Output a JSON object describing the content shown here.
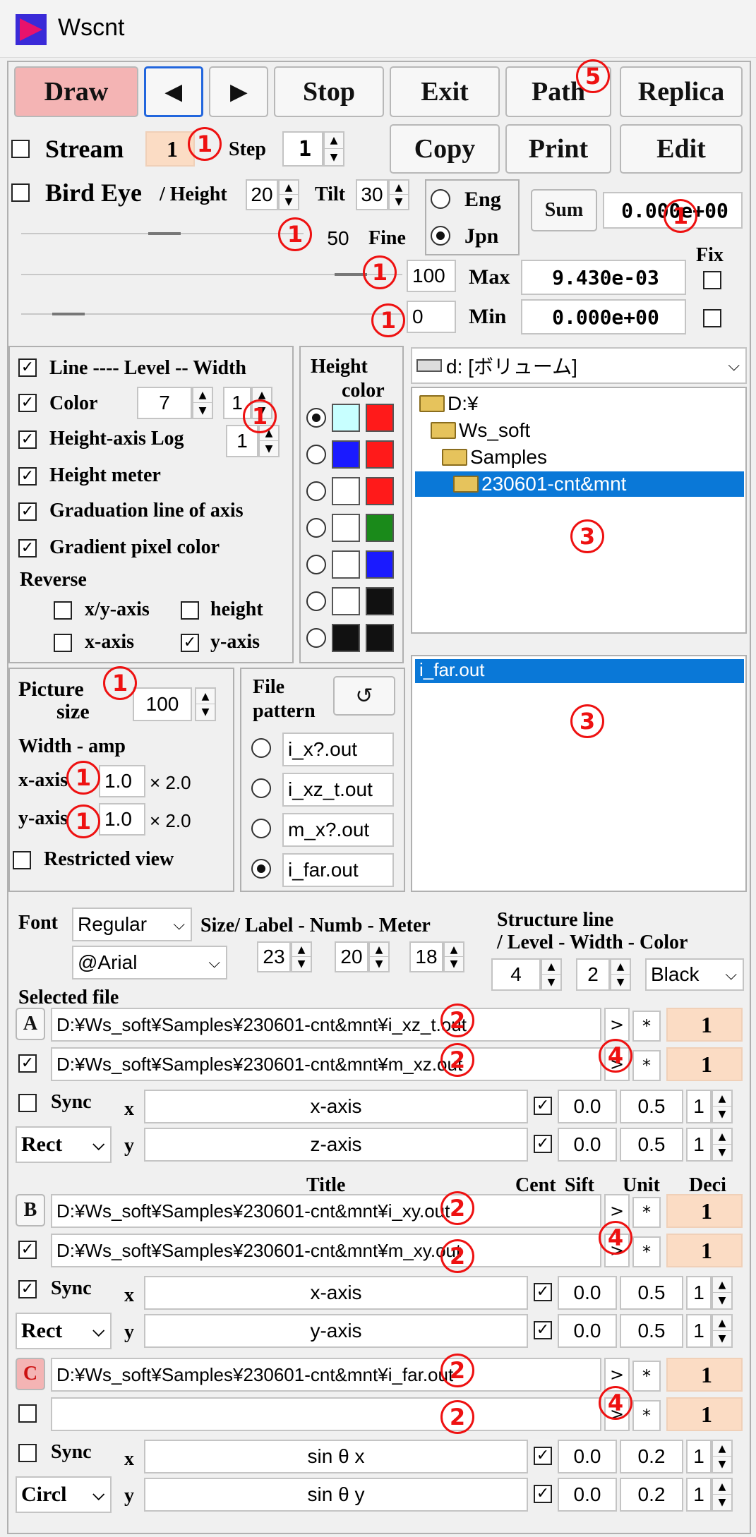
{
  "window": {
    "title": "Wscnt"
  },
  "toolbar": {
    "draw": "Draw",
    "prev": "◀",
    "next": "▶",
    "stop": "Stop",
    "exit": "Exit",
    "path": "Path",
    "replica": "Replica",
    "copy": "Copy",
    "print": "Print",
    "edit": "Edit"
  },
  "stream": {
    "label": "Stream",
    "value": "1",
    "step_label": "Step",
    "step_value": "1"
  },
  "bird": {
    "label": "Bird Eye",
    "height_label": "/ Height",
    "height_value": "20",
    "tilt_label": "Tilt",
    "tilt_value": "30",
    "fine_value": "50",
    "fine_label": "Fine"
  },
  "lang": {
    "eng": "Eng",
    "jpn": "Jpn",
    "selected": "Jpn"
  },
  "sum": {
    "button": "Sum",
    "value": "0.000e+00"
  },
  "range": {
    "fix_label": "Fix",
    "max_slider": "100",
    "max_label": "Max",
    "max_value": "9.430e-03",
    "min_slider": "0",
    "min_label": "Min",
    "min_value": "0.000e+00"
  },
  "options": {
    "line": "Line ---- Level -- Width",
    "color": "Color",
    "color_level": "7",
    "color_width": "1",
    "height_log": "Height-axis Log",
    "height_log_value": "1",
    "height_meter": "Height meter",
    "graduation": "Graduation line of axis",
    "gradient": "Gradient pixel color",
    "reverse": "Reverse",
    "xy_axis": "x/y-axis",
    "height": "height",
    "x_axis": "x-axis",
    "y_axis": "y-axis"
  },
  "height_color": {
    "title_1": "Height",
    "title_2": "color",
    "rows": [
      [
        "#c8ffff",
        "#ff1a1a"
      ],
      [
        "#1a1aff",
        "#ff1a1a"
      ],
      [
        "#ffffff",
        "#ff1a1a"
      ],
      [
        "#ffffff",
        "#1a8a1a"
      ],
      [
        "#ffffff",
        "#1a1aff"
      ],
      [
        "#ffffff",
        "#111111"
      ],
      [
        "#111111",
        "#111111"
      ]
    ]
  },
  "drive": {
    "selected": "d: [ボリューム]"
  },
  "folders": [
    "D:¥",
    "Ws_soft",
    "Samples",
    "230601-cnt&mnt"
  ],
  "files": [
    "i_far.out"
  ],
  "picture": {
    "label_1": "Picture",
    "label_2": "size",
    "value": "100",
    "width_amp": "Width - amp",
    "x_axis": "x-axis",
    "x_value": "1.0",
    "x_mult": "× 2.0",
    "y_axis": "y-axis",
    "y_value": "1.0",
    "y_mult": "× 2.0",
    "restricted": "Restricted view"
  },
  "pattern": {
    "label_1": "File",
    "label_2": "pattern",
    "refresh": "↺",
    "items": [
      "i_x?.out",
      "i_xz_t.out",
      "m_x?.out",
      "i_far.out"
    ],
    "selected": 3
  },
  "font": {
    "label": "Font",
    "style": "Regular",
    "face": "@Arial",
    "size_label": "Size/ Label - Numb - Meter",
    "label_size": "23",
    "numb_size": "20",
    "meter_size": "18"
  },
  "structure": {
    "label_1": "Structure line",
    "label_2": "/ Level - Width - Color",
    "level": "4",
    "width": "2",
    "color": "Black"
  },
  "selected_file": "Selected file",
  "col_headers": {
    "title": "Title",
    "cent": "Cent",
    "sift": "Sift",
    "unit": "Unit",
    "deci": "Deci"
  },
  "groups": [
    {
      "id": "A",
      "file1": "D:¥Ws_soft¥Samples¥230601-cnt&mnt¥i_xz_t.out",
      "file2": "D:¥Ws_soft¥Samples¥230601-cnt&mnt¥m_xz.out",
      "n1": "1",
      "n2": "1",
      "sync": "Sync",
      "shape": "Rect",
      "x_title": "x-axis",
      "y_title": "z-axis",
      "x_cent": "0.0",
      "x_sift": "0.5",
      "x_deci": "1",
      "y_cent": "0.0",
      "y_sift": "0.5",
      "y_deci": "1"
    },
    {
      "id": "B",
      "file1": "D:¥Ws_soft¥Samples¥230601-cnt&mnt¥i_xy.out",
      "file2": "D:¥Ws_soft¥Samples¥230601-cnt&mnt¥m_xy.out",
      "n1": "1",
      "n2": "1",
      "sync": "Sync",
      "shape": "Rect",
      "x_title": "x-axis",
      "y_title": "y-axis",
      "x_cent": "0.0",
      "x_sift": "0.5",
      "x_deci": "1",
      "y_cent": "0.0",
      "y_sift": "0.5",
      "y_deci": "1"
    },
    {
      "id": "C",
      "file1": "D:¥Ws_soft¥Samples¥230601-cnt&mnt¥i_far.out",
      "file2": "",
      "n1": "1",
      "n2": "1",
      "sync": "Sync",
      "shape": "Circl",
      "x_title": "sin θ x",
      "y_title": "sin θ y",
      "x_cent": "0.0",
      "x_sift": "0.2",
      "x_deci": "1",
      "y_cent": "0.0",
      "y_sift": "0.2",
      "y_deci": "1"
    }
  ],
  "row_axis": {
    "x": "x",
    "y": "y"
  },
  "file_btn": ">",
  "unit_btn": "*",
  "callouts": {
    "one": "1",
    "two": "2",
    "three": "3",
    "four": "4",
    "five": "5"
  },
  "colors": {
    "accent": "#2266dd",
    "callout": "#e11111",
    "peach": "#fbdcc4",
    "draw": "#f4b4b4"
  }
}
